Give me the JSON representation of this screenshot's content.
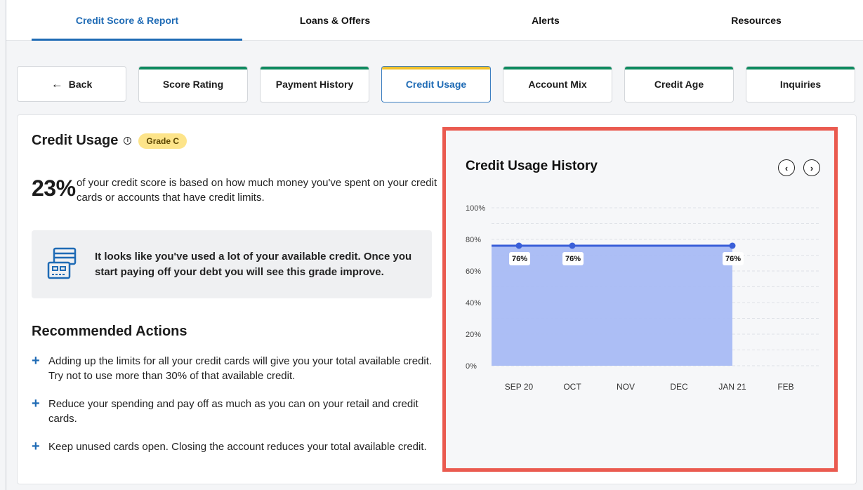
{
  "topnav": {
    "tabs": [
      {
        "label": "Credit Score & Report",
        "active": true
      },
      {
        "label": "Loans & Offers",
        "active": false
      },
      {
        "label": "Alerts",
        "active": false
      },
      {
        "label": "Resources",
        "active": false
      }
    ]
  },
  "subtabs": {
    "back_label": "Back",
    "items": [
      {
        "label": "Score Rating"
      },
      {
        "label": "Payment History"
      },
      {
        "label": "Credit Usage",
        "active": true
      },
      {
        "label": "Account Mix"
      },
      {
        "label": "Credit Age"
      },
      {
        "label": "Inquiries"
      }
    ]
  },
  "credit_usage": {
    "title": "Credit Usage",
    "grade": "Grade C",
    "percent": "23%",
    "description": "of your credit score is based on how much money you've spent on your credit cards or accounts that have credit limits.",
    "notice": "It looks like you've used a lot of your available credit. Once you start paying off your debt you will see this grade improve."
  },
  "recommended": {
    "title": "Recommended Actions",
    "items": [
      "Adding up the limits for all your credit cards will give you your total available credit. Try not to use more than 30% of that available credit.",
      "Reduce your spending and pay off as much as you can on your retail and credit cards.",
      "Keep unused cards open. Closing the account reduces your total available credit."
    ]
  },
  "chart_panel": {
    "title": "Credit Usage History",
    "prev_icon": "chevron-left-icon",
    "next_icon": "chevron-right-icon"
  },
  "chart_data": {
    "type": "area",
    "title": "Credit Usage History",
    "categories": [
      "SEP 20",
      "OCT",
      "NOV",
      "DEC",
      "JAN 21",
      "FEB"
    ],
    "y_ticks": [
      "0%",
      "20%",
      "40%",
      "60%",
      "80%",
      "100%"
    ],
    "ylim": [
      0,
      100
    ],
    "grid": true,
    "series": [
      {
        "values": [
          76,
          76,
          76,
          76,
          76,
          null
        ],
        "point_labels": [
          {
            "category": "SEP 20",
            "value": 76,
            "label": "76%"
          },
          {
            "category": "OCT",
            "value": 76,
            "label": "76%"
          },
          {
            "category": "JAN 21",
            "value": 76,
            "label": "76%"
          }
        ],
        "line_color": "#3a5fd8",
        "fill_color": "#a8baf4"
      }
    ]
  }
}
